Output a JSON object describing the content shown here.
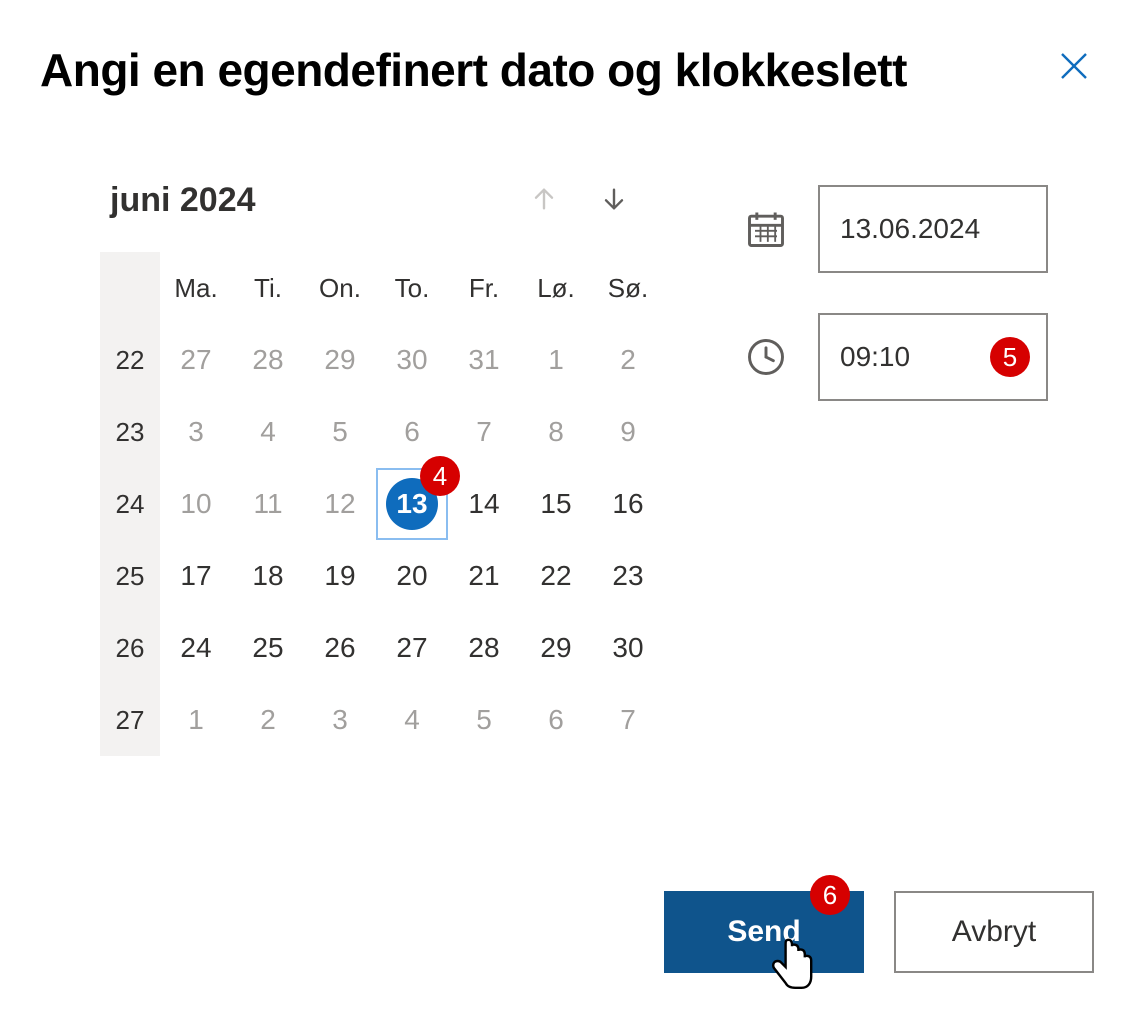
{
  "dialog": {
    "title": "Angi en egendefinert dato og klokkeslett"
  },
  "calendar": {
    "month_label": "juni 2024",
    "day_headers": [
      "Ma.",
      "Ti.",
      "On.",
      "To.",
      "Fr.",
      "Lø.",
      "Sø."
    ],
    "week_numbers": [
      "22",
      "23",
      "24",
      "25",
      "26",
      "27"
    ],
    "weeks": [
      [
        {
          "d": "27",
          "cls": "outside"
        },
        {
          "d": "28",
          "cls": "outside"
        },
        {
          "d": "29",
          "cls": "outside"
        },
        {
          "d": "30",
          "cls": "outside"
        },
        {
          "d": "31",
          "cls": "outside"
        },
        {
          "d": "1",
          "cls": "past"
        },
        {
          "d": "2",
          "cls": "past"
        }
      ],
      [
        {
          "d": "3",
          "cls": "past"
        },
        {
          "d": "4",
          "cls": "past"
        },
        {
          "d": "5",
          "cls": "past"
        },
        {
          "d": "6",
          "cls": "past"
        },
        {
          "d": "7",
          "cls": "past"
        },
        {
          "d": "8",
          "cls": "past"
        },
        {
          "d": "9",
          "cls": "past"
        }
      ],
      [
        {
          "d": "10",
          "cls": "past"
        },
        {
          "d": "11",
          "cls": "past"
        },
        {
          "d": "12",
          "cls": "past"
        },
        {
          "d": "13",
          "cls": "selected"
        },
        {
          "d": "14",
          "cls": ""
        },
        {
          "d": "15",
          "cls": ""
        },
        {
          "d": "16",
          "cls": ""
        }
      ],
      [
        {
          "d": "17",
          "cls": ""
        },
        {
          "d": "18",
          "cls": ""
        },
        {
          "d": "19",
          "cls": ""
        },
        {
          "d": "20",
          "cls": ""
        },
        {
          "d": "21",
          "cls": ""
        },
        {
          "d": "22",
          "cls": ""
        },
        {
          "d": "23",
          "cls": ""
        }
      ],
      [
        {
          "d": "24",
          "cls": ""
        },
        {
          "d": "25",
          "cls": ""
        },
        {
          "d": "26",
          "cls": ""
        },
        {
          "d": "27",
          "cls": ""
        },
        {
          "d": "28",
          "cls": ""
        },
        {
          "d": "29",
          "cls": ""
        },
        {
          "d": "30",
          "cls": ""
        }
      ],
      [
        {
          "d": "1",
          "cls": "outside"
        },
        {
          "d": "2",
          "cls": "outside"
        },
        {
          "d": "3",
          "cls": "outside"
        },
        {
          "d": "4",
          "cls": "outside"
        },
        {
          "d": "5",
          "cls": "outside"
        },
        {
          "d": "6",
          "cls": "outside"
        },
        {
          "d": "7",
          "cls": "outside"
        }
      ]
    ]
  },
  "fields": {
    "date_value": "13.06.2024",
    "time_value": "09:10"
  },
  "buttons": {
    "send": "Send",
    "cancel": "Avbryt"
  },
  "annotations": {
    "a4": "4",
    "a5": "5",
    "a6": "6"
  }
}
